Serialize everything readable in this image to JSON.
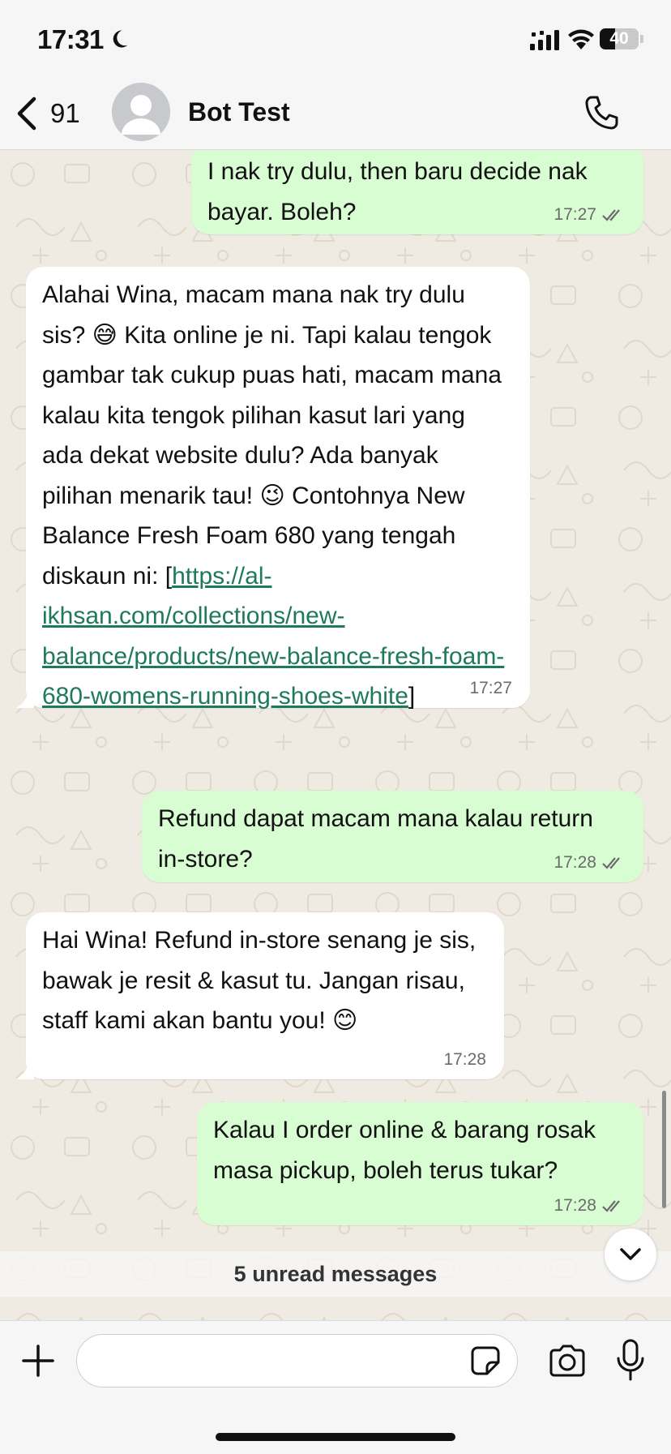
{
  "status_bar": {
    "time": "17:31",
    "battery": "40",
    "battery_level": 0.4,
    "icons": [
      "moon-icon",
      "signal-icon",
      "wifi-icon",
      "battery-icon"
    ]
  },
  "header": {
    "back_count": "91",
    "chat_name": "Bot Test",
    "icons": [
      "chevron-left-icon",
      "avatar-icon",
      "phone-icon"
    ]
  },
  "messages": [
    {
      "direction": "outgoing",
      "text": "I nak try dulu, then baru decide nak bayar. Boleh?",
      "time": "17:27",
      "read": true
    },
    {
      "direction": "incoming",
      "text_before_link": "Alahai Wina, macam mana nak try dulu sis? 😅 Kita online je ni.  Tapi kalau tengok gambar tak cukup puas hati, macam mana kalau kita tengok pilihan kasut lari yang ada dekat website dulu? Ada banyak pilihan menarik tau! 😉 Contohnya New Balance Fresh Foam 680 yang tengah diskaun ni: [",
      "link": "https://al-ikhsan.com/collections/new-balance/products/new-balance-fresh-foam-680-womens-running-shoes-white",
      "text_after_link": "]",
      "time": "17:27"
    },
    {
      "direction": "outgoing",
      "text": "Refund dapat macam mana kalau return in-store?",
      "time": "17:28",
      "read": true
    },
    {
      "direction": "incoming",
      "text": "Hai Wina!  Refund in-store senang je sis, bawak je resit & kasut tu.  Jangan risau, staff kami akan bantu you! 😊",
      "time": "17:28"
    },
    {
      "direction": "outgoing",
      "text": "Kalau I order online & barang rosak masa pickup, boleh terus tukar?",
      "time": "17:28",
      "read": true
    }
  ],
  "unread_banner": "5 unread messages",
  "input_bar": {
    "placeholder": "",
    "icons": [
      "plus-icon",
      "sticker-icon",
      "camera-icon",
      "microphone-icon"
    ]
  },
  "colors": {
    "outgoing_bubble": "#d9fdd3",
    "incoming_bubble": "#ffffff",
    "link": "#1f7a5b",
    "wallpaper": "#efeae2"
  }
}
